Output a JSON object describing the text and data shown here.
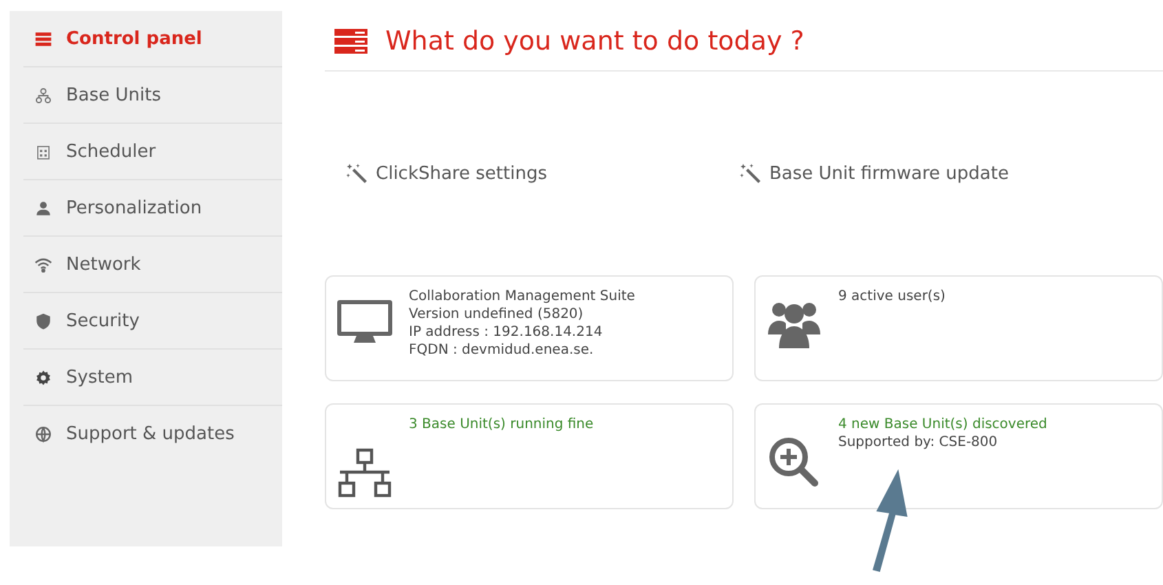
{
  "sidebar": {
    "items": [
      {
        "label": "Control panel",
        "selected": true
      },
      {
        "label": "Base Units",
        "selected": false
      },
      {
        "label": "Scheduler",
        "selected": false
      },
      {
        "label": "Personalization",
        "selected": false
      },
      {
        "label": "Network",
        "selected": false
      },
      {
        "label": "Security",
        "selected": false
      },
      {
        "label": "System",
        "selected": false
      },
      {
        "label": "Support & updates",
        "selected": false
      }
    ]
  },
  "header": {
    "title": "What do you want to do today ?"
  },
  "actions": [
    {
      "label": "ClickShare settings"
    },
    {
      "label": "Base Unit firmware update"
    }
  ],
  "cards": [
    {
      "lines": [
        {
          "text": "Collaboration Management Suite",
          "kind": "plain"
        },
        {
          "text": "Version undefined (5820)",
          "kind": "plain"
        },
        {
          "text": "IP address : 192.168.14.214",
          "kind": "plain"
        },
        {
          "text": "FQDN : devmidud.enea.se.",
          "kind": "plain"
        }
      ]
    },
    {
      "lines": [
        {
          "text": "9 active user(s)",
          "kind": "plain"
        }
      ]
    },
    {
      "lines": [
        {
          "text": "3 Base Unit(s) running fine",
          "kind": "status"
        }
      ]
    },
    {
      "lines": [
        {
          "text": "4 new Base Unit(s) discovered",
          "kind": "status"
        },
        {
          "text": "Supported by: CSE-800",
          "kind": "plain"
        }
      ]
    }
  ]
}
